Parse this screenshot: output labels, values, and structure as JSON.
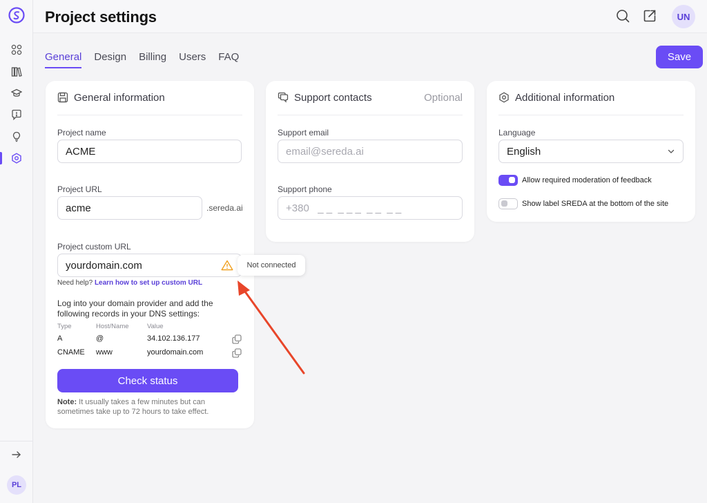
{
  "sidebar": {
    "items": [
      {
        "icon": "grid-icon"
      },
      {
        "icon": "library-icon"
      },
      {
        "icon": "graduation-cap-icon"
      },
      {
        "icon": "feedback-icon"
      },
      {
        "icon": "lightbulb-icon"
      },
      {
        "icon": "settings-hexagon-icon",
        "active": true
      }
    ],
    "collapse_icon": "arrow-right-icon",
    "avatar": "PL"
  },
  "header": {
    "title": "Project settings",
    "avatar": "UN"
  },
  "tabs": [
    {
      "label": "General",
      "active": true
    },
    {
      "label": "Design"
    },
    {
      "label": "Billing"
    },
    {
      "label": "Users"
    },
    {
      "label": "FAQ"
    }
  ],
  "save_label": "Save",
  "general": {
    "title": "General information",
    "project_name_label": "Project name",
    "project_name_value": "ACME",
    "project_url_label": "Project URL",
    "project_url_value": "acme",
    "project_url_suffix": ".sereda.ai",
    "custom_url_label": "Project custom URL",
    "custom_url_value": "yourdomain.com",
    "tooltip": "Not connected",
    "help_prefix": "Need help?",
    "help_link": "Learn how to set up custom URL",
    "dns_intro": "Log into your domain provider and add the following records in your DNS settings:",
    "dns_headers": {
      "type": "Type",
      "host": "Host/Name",
      "value": "Value"
    },
    "dns_rows": [
      {
        "type": "A",
        "host": "@",
        "value": "34.102.136.177"
      },
      {
        "type": "CNAME",
        "host": "www",
        "value": "yourdomain.com"
      }
    ],
    "check_status_label": "Check status",
    "note_label": "Note:",
    "note_text": "It usually takes a few minutes but can sometimes take up to 72 hours to take effect."
  },
  "support": {
    "title": "Support contacts",
    "optional": "Optional",
    "email_label": "Support email",
    "email_placeholder": "email@sereda.ai",
    "phone_label": "Support phone",
    "phone_placeholder": "+380   _ _  _ _ _  _ _  _ _"
  },
  "additional": {
    "title": "Additional information",
    "language_label": "Language",
    "language_value": "English",
    "toggles": [
      {
        "label": "Allow required moderation of feedback",
        "on": true
      },
      {
        "label": "Show label SREDA at the bottom of the site",
        "on": false
      }
    ]
  },
  "colors": {
    "accent": "#6a4cf5",
    "warning": "#f0a020",
    "annotation_arrow": "#e8462a"
  }
}
